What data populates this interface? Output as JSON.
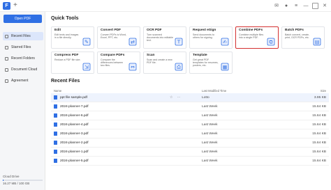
{
  "titlebar": {
    "logo_letter": "F",
    "new_tab": "+"
  },
  "sidebar": {
    "open_button": "Open PDF",
    "items": [
      {
        "label": "Recent Files",
        "active": true
      },
      {
        "label": "Starred Files",
        "active": false
      },
      {
        "label": "Recent Folders",
        "active": false
      },
      {
        "label": "Document Cloud",
        "active": false
      },
      {
        "label": "Agreement",
        "active": false
      }
    ],
    "storage_label": "Cloud Drive",
    "storage_value": "16.27 MB / 100 GB",
    "storage_fraction": 0.02
  },
  "quick_tools": {
    "title": "Quick Tools",
    "tools": [
      {
        "title": "Edit",
        "desc": "Edit texts and images in a file directly."
      },
      {
        "title": "Convert PDF",
        "desc": "Convert PDFs to Word, Excel, PPT, etc."
      },
      {
        "title": "OCR PDF",
        "desc": "Turn scanned documents into editable text."
      },
      {
        "title": "Request eSign",
        "desc": "Send documents to others for signing."
      },
      {
        "title": "Combine PDFs",
        "desc": "Combine multiple files into a single PDF.",
        "highlight": true
      },
      {
        "title": "Batch PDFs",
        "desc": "Batch convert, create, print, OCR PDFs, etc."
      },
      {
        "title": "Compress PDF",
        "desc": "Reduce a PDF file size."
      },
      {
        "title": "Compare PDFs",
        "desc": "Compare the differences between two files."
      },
      {
        "title": "Scan",
        "desc": "Scan and create a new PDF file."
      },
      {
        "title": "Template",
        "desc": "Get great PDF templates for resumes, posters, etc."
      }
    ]
  },
  "recent_files": {
    "title": "Recent Files",
    "columns": {
      "name": "Name",
      "time": "Last Modified Time",
      "size": "Size"
    },
    "rows": [
      {
        "name": "ppt file sample.pdf",
        "time": "Lotto",
        "size": "3.95 KB"
      },
      {
        "name": "2024-planner-7.pdf",
        "time": "Last Week",
        "size": "15.64 KB"
      },
      {
        "name": "2024-planner-6.pdf",
        "time": "Last Week",
        "size": "15.64 KB"
      },
      {
        "name": "2024-planner-4.pdf",
        "time": "Last Week",
        "size": "15.64 KB"
      },
      {
        "name": "2024-planner-3.pdf",
        "time": "Last Week",
        "size": "15.64 KB"
      },
      {
        "name": "2024-planner-2.pdf",
        "time": "Last Week",
        "size": "15.64 KB"
      },
      {
        "name": "2024-planner-1.pdf",
        "time": "Last Week",
        "size": "15.64 KB"
      },
      {
        "name": "2024-planner-5.pdf",
        "time": "Last Week",
        "size": "15.64 KB"
      }
    ]
  },
  "colors": {
    "accent": "#2f6fe4",
    "highlight": "#d32f2f"
  }
}
